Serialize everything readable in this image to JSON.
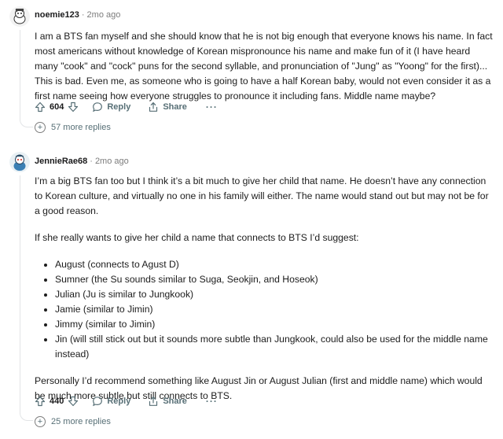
{
  "comments": [
    {
      "username": "noemie123",
      "separator": "·",
      "time": "2mo ago",
      "body": "I am a BTS fan myself and she should know that he is not big enough that everyone knows his name. In fact most americans without knowledge of Korean mispronounce his name and make fun of it (I have heard many \"cook\" and \"cock\" puns for the second syllable, and pronunciation of \"Jung\" as \"Yoong\" for the first)... This is bad. Even me, as someone who is going to have a half Korean baby, would not even consider it as a first name seeing how everyone struggles to pronounce it including fans. Middle name maybe?",
      "score": "604",
      "reply_label": "Reply",
      "share_label": "Share",
      "more_label": "···",
      "more_replies": "57 more replies",
      "upvote_icon": "arrow-up-icon",
      "downvote_icon": "arrow-down-icon"
    },
    {
      "username": "JennieRae68",
      "separator": "·",
      "time": "2mo ago",
      "paragraph1": "I’m a big BTS fan too but I think it’s a bit much to give her child that name. He doesn’t have any connection to Korean culture, and virtually no one in his family will either. The name would stand out but may not be for a good reason.",
      "paragraph2": "If she really wants to give her child a name that connects to BTS I’d suggest:",
      "bullets": [
        "August (connects to Agust D)",
        "Sumner (the Su sounds similar to Suga, Seokjin, and Hoseok)",
        "Julian (Ju is similar to Jungkook)",
        "Jamie (similar to Jimin)",
        "Jimmy (similar to Jimin)",
        "Jin (will still stick out but it sounds more subtle than Jungkook, could also be used for the middle name instead)"
      ],
      "paragraph3": "Personally I’d recommend something like August Jin or August Julian (first and middle name) which would be much more subtle but still connects to BTS.",
      "score": "440",
      "reply_label": "Reply",
      "share_label": "Share",
      "more_label": "···",
      "more_replies": "25 more replies"
    }
  ],
  "colors": {
    "text": "#1c1c1c",
    "meta": "#7c7c7c",
    "action": "#576f76",
    "thread": "#e2e4e6"
  }
}
